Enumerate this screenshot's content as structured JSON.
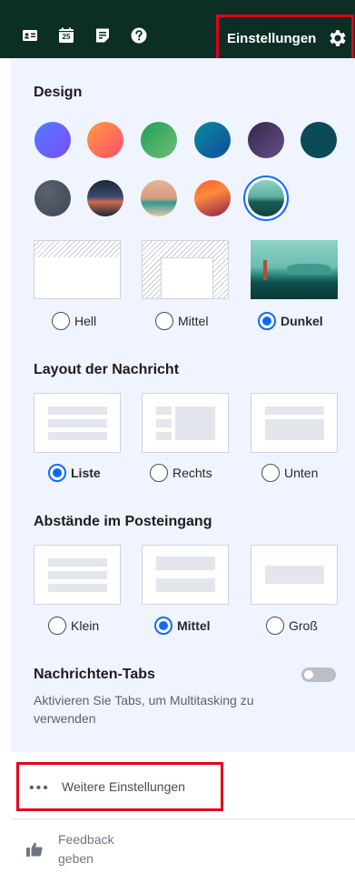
{
  "topbar": {
    "icons": [
      "contacts-card-icon",
      "calendar-icon",
      "notepad-icon",
      "help-icon"
    ],
    "calendar_day": "25",
    "settings_label": "Einstellungen",
    "settings_icon": "gear-icon"
  },
  "design": {
    "title": "Design",
    "color_themes": [
      {
        "name": "blue-purple",
        "colors": [
          "#4f7cff",
          "#7b4dff"
        ]
      },
      {
        "name": "coral",
        "colors": [
          "#ff9a3c",
          "#ff4d6d"
        ]
      },
      {
        "name": "green",
        "colors": [
          "#1f9e5a",
          "#6fbf73"
        ]
      },
      {
        "name": "teal-blue",
        "colors": [
          "#0a8a9c",
          "#0f4c9e"
        ]
      },
      {
        "name": "purple-dark",
        "colors": [
          "#2f2a4a",
          "#6a4d86"
        ]
      },
      {
        "name": "dark-teal",
        "colors": [
          "#0b4a57",
          "#0b4a57"
        ]
      }
    ],
    "photo_themes": [
      {
        "name": "slate",
        "colors": [
          "#3e4652",
          "#5a6270"
        ],
        "selected": false
      },
      {
        "name": "mountains",
        "colors": [
          "#1c2436",
          "#c96a4f"
        ],
        "selected": false
      },
      {
        "name": "beach",
        "colors": [
          "#e6b59a",
          "#2f9a8e"
        ],
        "selected": false
      },
      {
        "name": "sunset",
        "colors": [
          "#ff5c2e",
          "#8a1f4a"
        ],
        "selected": false
      },
      {
        "name": "lake",
        "colors": [
          "#8ad1c4",
          "#1b5e5a"
        ],
        "selected": true
      }
    ],
    "modes": [
      {
        "label": "Hell",
        "selected": false
      },
      {
        "label": "Mittel",
        "selected": false
      },
      {
        "label": "Dunkel",
        "selected": true
      }
    ]
  },
  "layout": {
    "title": "Layout der Nachricht",
    "options": [
      {
        "label": "Liste",
        "selected": true
      },
      {
        "label": "Rechts",
        "selected": false
      },
      {
        "label": "Unten",
        "selected": false
      }
    ]
  },
  "spacing": {
    "title": "Abstände im Posteingang",
    "options": [
      {
        "label": "Klein",
        "selected": false
      },
      {
        "label": "Mittel",
        "selected": true
      },
      {
        "label": "Groß",
        "selected": false
      }
    ]
  },
  "tabs": {
    "title": "Nachrichten-Tabs",
    "description": "Aktivieren Sie Tabs, um Multitasking zu verwenden",
    "enabled": false
  },
  "more": {
    "label": "Weitere Einstellungen",
    "icon": "more-dots-icon"
  },
  "feedback": {
    "label": "Feedback geben",
    "icon": "thumbs-up-icon"
  },
  "colors": {
    "topbar": "#0b2e25",
    "accent": "#0f69ff",
    "highlight": "#e0001b",
    "panel": "#f0f4ff"
  }
}
